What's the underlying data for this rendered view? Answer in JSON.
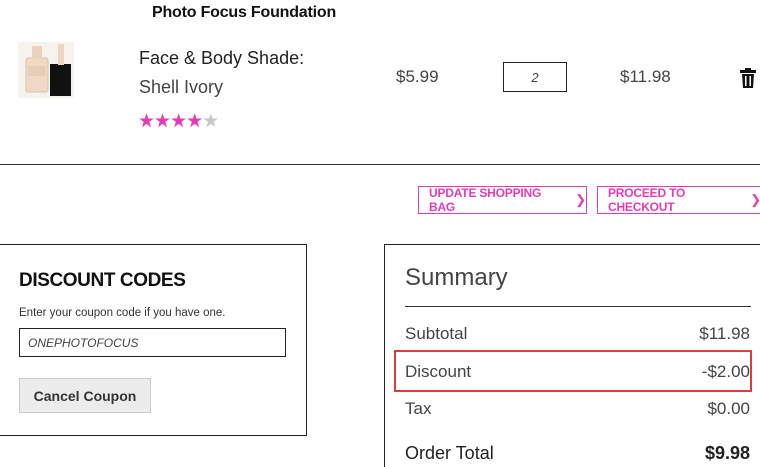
{
  "product": {
    "title": "Photo Focus Foundation",
    "shade_label": "Face & Body Shade:",
    "shade_value": "Shell Ivory",
    "rating": 4,
    "rating_max": 5,
    "price": "$5.99",
    "quantity": "2",
    "line_total": "$11.98"
  },
  "actions": {
    "update_label": "UPDATE SHOPPING BAG",
    "checkout_label": "PROCEED TO CHECKOUT"
  },
  "discount": {
    "title": "DISCOUNT CODES",
    "hint": "Enter your coupon code if you have one.",
    "coupon_value": "ONEPHOTOFOCUS",
    "cancel_label": "Cancel Coupon"
  },
  "summary": {
    "title": "Summary",
    "subtotal_label": "Subtotal",
    "subtotal_value": "$11.98",
    "discount_label": "Discount",
    "discount_value": "-$2.00",
    "tax_label": "Tax",
    "tax_value": "$0.00",
    "total_label": "Order Total",
    "total_value": "$9.98"
  },
  "colors": {
    "accent": "#e63bb5",
    "highlight": "#e03c3c"
  },
  "icons": {
    "trash": "trash-icon",
    "chevron": "chevron-right-icon",
    "star": "star-icon"
  }
}
